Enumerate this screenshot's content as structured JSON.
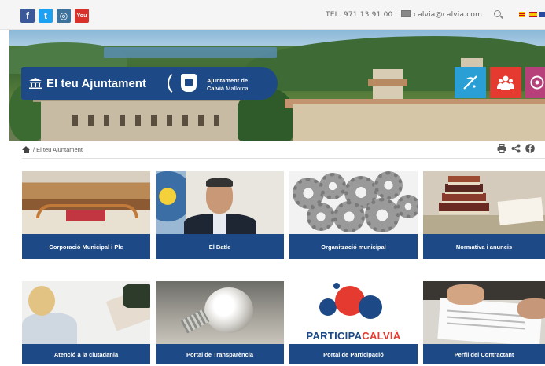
{
  "topbar": {
    "social": {
      "facebook": "f",
      "twitter": "t",
      "instagram": "◎",
      "youtube": "You"
    },
    "phone": "TEL. 971 13 91 00",
    "email": "calvia@calvia.com",
    "icons": [
      "facebook-icon",
      "twitter-icon",
      "instagram-icon",
      "youtube-icon",
      "mail-icon",
      "search-icon"
    ]
  },
  "hero": {
    "title": "El teu Ajuntament",
    "logo_line1": "Ajuntament de",
    "logo_line2_bold": "Calvià",
    "logo_line2": "Mallorca",
    "quick_buttons": [
      "weather-icon",
      "people-icon",
      "info-icon"
    ],
    "colors": {
      "brand": "#1d4a86",
      "cyan": "#2a9fd6",
      "red": "#e53a2f",
      "magenta": "#b8407a"
    }
  },
  "breadcrumb": {
    "current": "/ El teu Ajuntament",
    "tools": [
      "print-icon",
      "share-icon",
      "facebook-icon"
    ]
  },
  "tiles": [
    {
      "label": "Corporació Municipal i Ple"
    },
    {
      "label": "El Batle"
    },
    {
      "label": "Organització municipal"
    },
    {
      "label": "Normativa i anuncis"
    },
    {
      "label": "Atenció a la ciutadania"
    },
    {
      "label": "Portal de Transparència"
    },
    {
      "label": "Portal de Participació",
      "logo_part1": "PARTICIPA",
      "logo_part2": "CALVIÀ"
    },
    {
      "label": "Perfil del Contractant"
    }
  ]
}
